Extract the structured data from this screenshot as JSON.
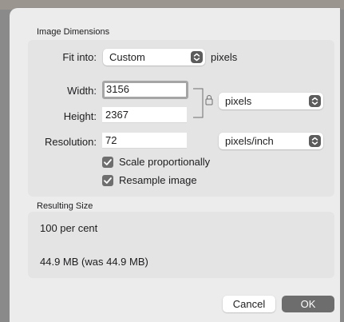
{
  "image_dimensions": {
    "title": "Image Dimensions",
    "fit_into": {
      "label": "Fit into:",
      "value": "Custom",
      "unit": "pixels"
    },
    "width": {
      "label": "Width:",
      "value": "3156"
    },
    "height": {
      "label": "Height:",
      "value": "2367"
    },
    "size_unit": "pixels",
    "resolution": {
      "label": "Resolution:",
      "value": "72",
      "unit": "pixels/inch"
    },
    "scale_proportionally": {
      "label": "Scale proportionally",
      "checked": true
    },
    "resample_image": {
      "label": "Resample image",
      "checked": true
    },
    "lock_icon": "lock-icon"
  },
  "resulting_size": {
    "title": "Resulting Size",
    "percent": "100 per cent",
    "file_size": "44.9 MB (was 44.9 MB)"
  },
  "buttons": {
    "cancel": "Cancel",
    "ok": "OK"
  },
  "colors": {
    "accent_gray": "#6d6d6d",
    "panel": "#ececec",
    "box": "#e4e4e4"
  }
}
